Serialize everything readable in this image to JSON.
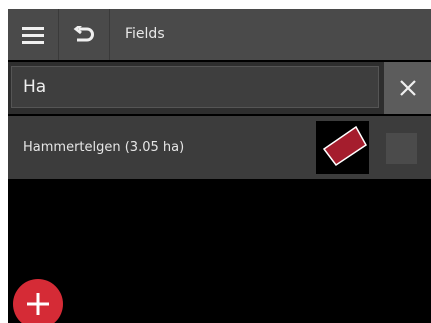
{
  "header": {
    "title": "Fields",
    "menu_icon": "hamburger-menu-icon",
    "back_icon": "back-arrow-icon"
  },
  "search": {
    "value": "Ha",
    "clear_icon": "close-icon"
  },
  "fields": [
    {
      "label": "Hammertelgen (3.05 ha)",
      "thumbnail_color": "#a51d2d",
      "selected": false
    }
  ],
  "fab": {
    "icon": "plus-icon",
    "color": "#d52b36"
  }
}
